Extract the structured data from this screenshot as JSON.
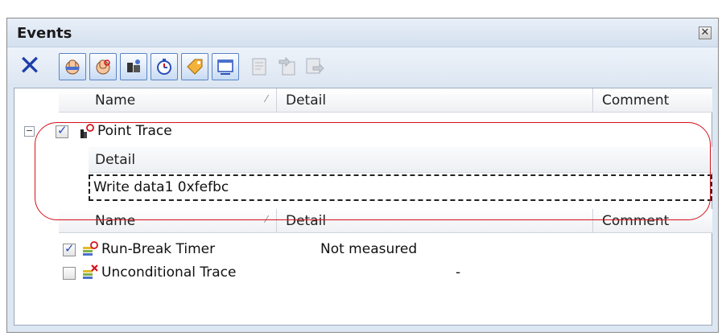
{
  "window": {
    "title": "Events",
    "close_icon": "close-icon"
  },
  "toolbar": {
    "delete_icon": "delete-icon",
    "buttons": [
      {
        "name": "hardware-break-icon"
      },
      {
        "name": "software-break-icon"
      },
      {
        "name": "trace-icon"
      },
      {
        "name": "timer-icon"
      },
      {
        "name": "tag-icon"
      },
      {
        "name": "console-icon"
      }
    ],
    "disabled_buttons": [
      {
        "name": "properties-icon"
      },
      {
        "name": "import-icon"
      },
      {
        "name": "export-icon"
      }
    ]
  },
  "columns": {
    "name": "Name",
    "detail": "Detail",
    "comment": "Comment"
  },
  "groups": [
    {
      "expanded": true,
      "expander_symbol": "−",
      "checked": true,
      "label": "Point Trace",
      "icon": "point-trace-icon",
      "detail_header": "Detail",
      "detail_value": "Write data1 0xfefbc"
    }
  ],
  "events": [
    {
      "checked": true,
      "label": "Run-Break Timer",
      "icon": "run-break-timer-icon",
      "detail": "Not measured",
      "comment": ""
    },
    {
      "checked": false,
      "label": "Unconditional Trace",
      "icon": "unconditional-trace-icon",
      "detail": "-",
      "comment": ""
    }
  ],
  "colors": {
    "accent": "#1c3fa8",
    "highlight": "#d6101a",
    "panel_bg": "#dde7f3"
  }
}
